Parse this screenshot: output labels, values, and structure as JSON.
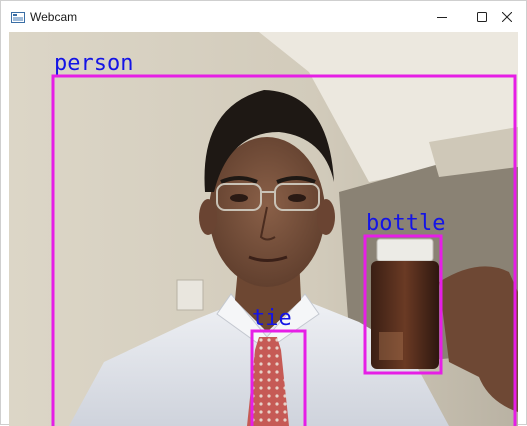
{
  "window": {
    "title": "Webcam",
    "app_icon": "webcam-window-icon",
    "controls": {
      "minimize": "minimize-icon",
      "maximize": "maximize-icon",
      "close": "close-icon"
    }
  },
  "detections": {
    "box_color": "#e61ee6",
    "label_color": "#1414e6",
    "items": [
      {
        "label": "person"
      },
      {
        "label": "bottle"
      },
      {
        "label": "tie"
      }
    ]
  }
}
